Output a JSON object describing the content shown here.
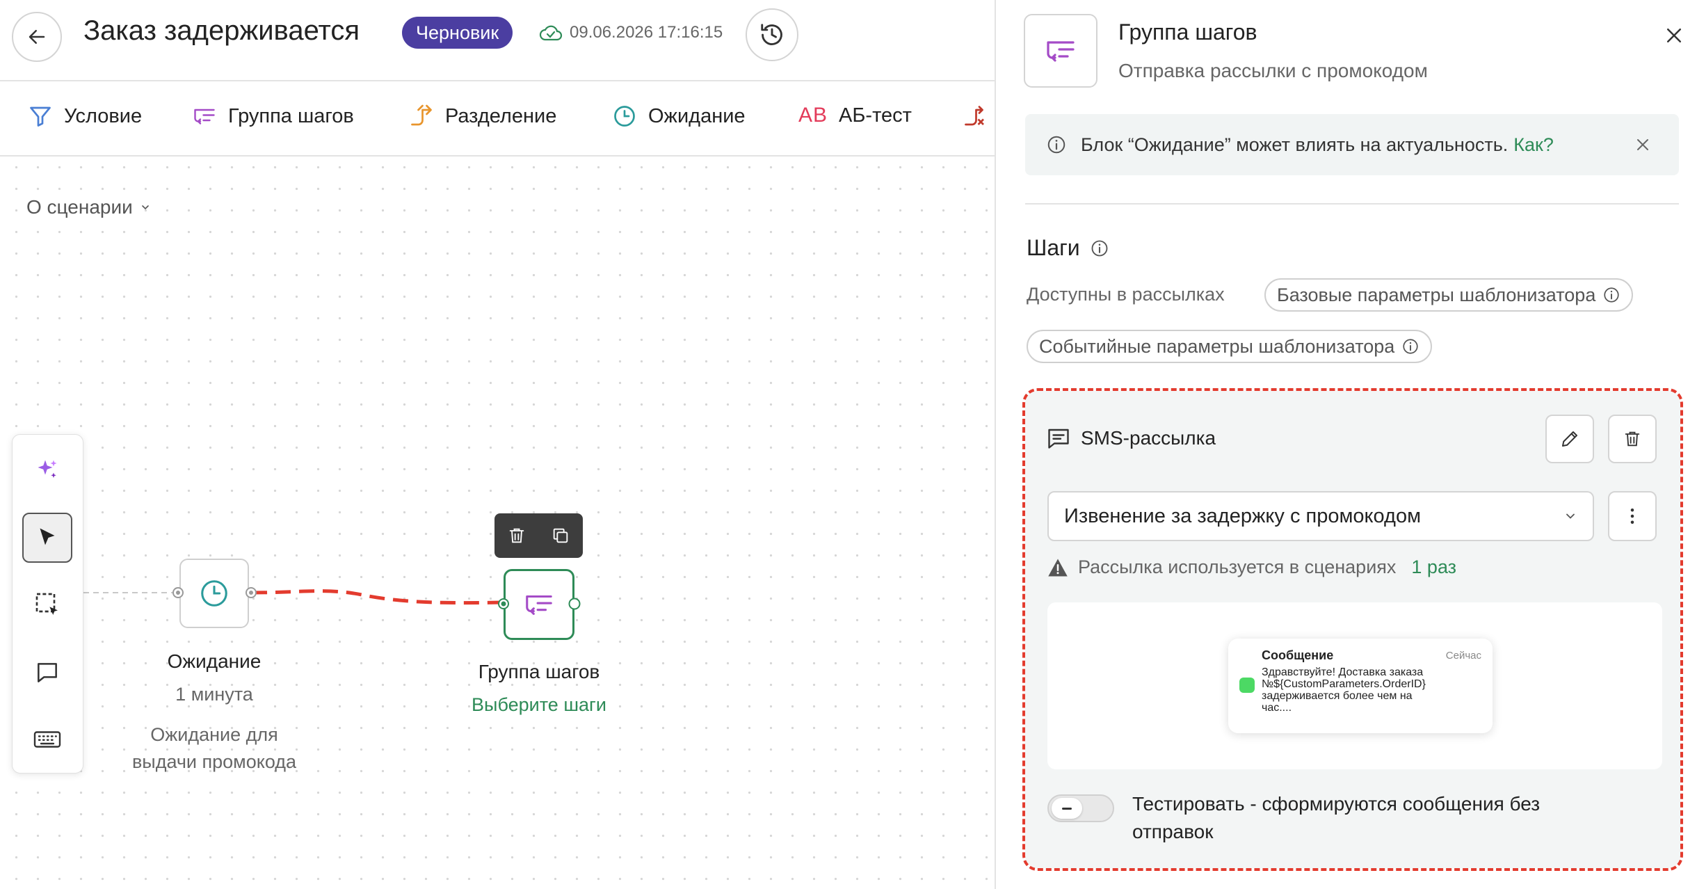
{
  "header": {
    "title": "Заказ задерживается",
    "status_badge": "Черновик",
    "saved_at": "09.06.2026 17:16:15"
  },
  "toolbar": {
    "items": [
      {
        "label": "Условие",
        "icon": "funnel-icon"
      },
      {
        "label": "Группа шагов",
        "icon": "steps-group-icon"
      },
      {
        "label": "Разделение",
        "icon": "split-icon"
      },
      {
        "label": "Ожидание",
        "icon": "clock-icon"
      },
      {
        "label": "АБ-тест",
        "icon": "ab-icon"
      }
    ],
    "ab_icon_text": "AB"
  },
  "canvas": {
    "scenario_dropdown": "О сценарии",
    "wait_node": {
      "title": "Ожидание",
      "duration": "1 минута",
      "description_line1": "Ожидание для",
      "description_line2": "выдачи промокода"
    },
    "group_node": {
      "title": "Группа шагов",
      "link": "Выберите шаги"
    }
  },
  "palette": [
    "sparkles-icon",
    "cursor-icon",
    "selection-icon",
    "comment-icon",
    "keyboard-icon"
  ],
  "panel": {
    "title": "Группа шагов",
    "subtitle": "Отправка рассылки с промокодом",
    "alert_text": "Блок “Ожидание” может влиять на актуальность.",
    "alert_link": "Как?",
    "steps_title": "Шаги",
    "available_label": "Доступны в рассылках",
    "chips": [
      "Базовые параметры шаблонизатора",
      "Событийные параметры шаблонизатора"
    ],
    "sms": {
      "title": "SMS-рассылка",
      "selected": "Извенение за задержку с промокодом",
      "usage_text": "Рассылка используется в сценариях",
      "usage_link": "1 раз",
      "preview": {
        "header": "Сообщение",
        "time": "Сейчас",
        "line1": "Здравствуйте! Доставка заказа",
        "line2": "№${CustomParameters.OrderID}",
        "line3": "задерживается более чем на",
        "line4": "час...."
      },
      "test_toggle_line1": "Тестировать - сформируются сообщения без",
      "test_toggle_line2": "отправок"
    }
  },
  "colors": {
    "accent_green": "#2e8b57",
    "badge_purple": "#4b3ea1",
    "highlight_red": "#e33b2e",
    "icon_purple": "#a44bc7",
    "icon_orange": "#e8952c",
    "icon_teal": "#2b9b9b"
  }
}
